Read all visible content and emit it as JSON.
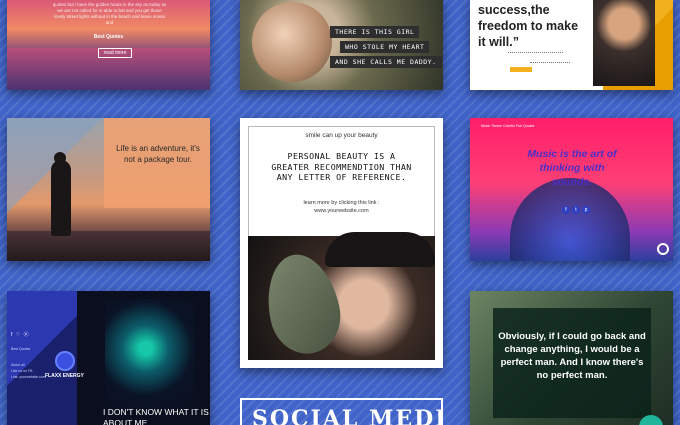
{
  "cards": {
    "sunset": {
      "body": "quotes but i have the golden hours in the sky as today as we are not called for in able to bet and you get those lovely street lights without in the beach and leave ocean and",
      "brand": "Best Quotes",
      "button": "read more"
    },
    "father_daughter": {
      "lines": [
        "THERE IS THIS GIRL",
        "WHO STOLE MY HEART",
        "AND SHE CALLS ME DADDY."
      ]
    },
    "success": {
      "quote": "success,the freedom to make it will.”"
    },
    "hiker": {
      "quote": "Life is an adventure, it's not a package tour."
    },
    "center": {
      "tagline": "smile can up your beauty",
      "headline": "PERSONAL BEAUTY IS A GREATER RECOMMENDTION THAN ANY LETTER OF REFERENCE.",
      "learn": "learn more by clicking this link :",
      "website": "www.yourwebsite.com"
    },
    "neon": {
      "header": "Music Theme Colorful Pub Quotes",
      "quote": "Music is the art of thinking with",
      "quote2": "sounds."
    },
    "energy": {
      "social": "f ♡ ⓟ",
      "label": "Best Quotes",
      "details": [
        "About all",
        "Like us on FB",
        "Link: yourwebsite.com"
      ],
      "brand": "FLAXX ENERGY",
      "quote": "I DON'T KNOW WHAT IT IS ABOUT ME..."
    },
    "banner": {
      "title": "SOCIAL MEDIA"
    },
    "green": {
      "quote": "Obviously, if I could go back and change anything, I would be a perfect man. And I know there's no perfect man."
    }
  }
}
